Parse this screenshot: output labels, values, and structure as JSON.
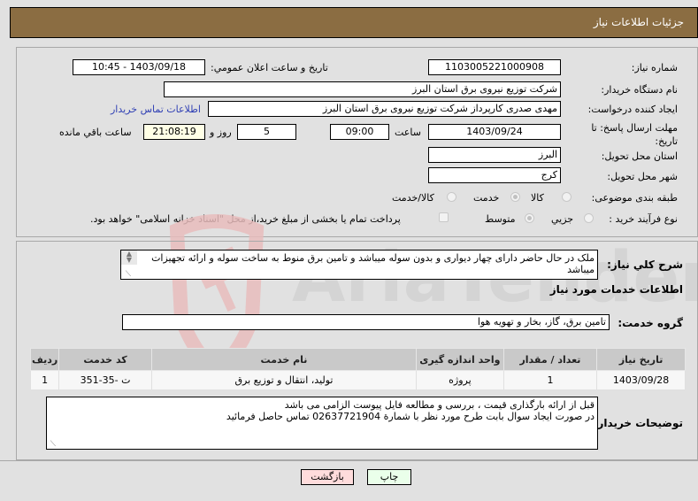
{
  "header": {
    "title": "جزئیات اطلاعات نیاز"
  },
  "form": {
    "need_number_label": "شماره نیاز:",
    "need_number": "1103005221000908",
    "announce_label": "تاریخ و ساعت اعلان عمومي:",
    "announce_value": "1403/09/18 - 10:45",
    "buyer_org_label": "نام دستگاه خریدار:",
    "buyer_org": "شرکت توزیع نیروی برق استان البرز",
    "creator_label": "ایجاد کننده درخواست:",
    "creator": "مهدی صدری کارپرداز شرکت توزیع نیروی برق استان البرز",
    "contact_link": "اطلاعات تماس خریدار",
    "deadline_label_1": "مهلت ارسال پاسخ: تا",
    "deadline_label_2": "تاریخ:",
    "deadline_date": "1403/09/24",
    "time_label": "ساعت",
    "deadline_time": "09:00",
    "days_value": "5",
    "days_label": "روز و",
    "remaining_time": "21:08:19",
    "remaining_label": "ساعت باقي مانده",
    "province_label": "استان محل تحویل:",
    "province": "البرز",
    "city_label": "شهر محل تحویل:",
    "city": "کرج",
    "category_label": "طبقه بندی موضوعی:",
    "category_options": [
      {
        "label": "کالا",
        "selected": false
      },
      {
        "label": "خدمت",
        "selected": true
      },
      {
        "label": "کالا/خدمت",
        "selected": false
      }
    ],
    "process_label": "نوع فرآیند خرید :",
    "process_options": [
      {
        "label": "جزیي",
        "selected": false
      },
      {
        "label": "متوسط",
        "selected": true
      }
    ],
    "treasury_checkbox_label": "پرداخت تمام یا بخشی از مبلغ خرید،از محل \"اسناد خزانه اسلامی\" خواهد بود."
  },
  "description": {
    "label": "شرح کلي نیاز:",
    "text": "ملک در حال حاضر دارای چهار دیواری و بدون سوله میباشد و تامین برق منوط به ساخت سوله و ارائه تجهیزات میباشد"
  },
  "services": {
    "section_title": "اطلاعات خدمات مورد نیاز",
    "group_label": "گروه خدمت:",
    "group_value": "تامین برق، گاز، بخار و تهویه هوا",
    "table": {
      "headers": [
        "ردیف",
        "کد خدمت",
        "نام خدمت",
        "واحد اندازه گیری",
        "تعداد / مقدار",
        "تاریخ نیاز"
      ],
      "rows": [
        [
          "1",
          "ت -35-351",
          "تولید، انتقال و توزیع برق",
          "پروژه",
          "1",
          "1403/09/28"
        ]
      ]
    }
  },
  "buyer_notes": {
    "label": "توضیحات خریدار:",
    "text": "قبل از ارائه بارگذاری قیمت ، بررسی و مطالعه فایل پیوست الزامی می باشد\nدر صورت ایجاد سوال بابت طرح مورد نظر با شمارة 02637721904 تماس حاصل فرمائید"
  },
  "buttons": {
    "print": "چاپ",
    "back": "بازگشت"
  },
  "watermark": {
    "text": "AriaTender.neT"
  },
  "colors": {
    "header_bg": "#8b6d42",
    "print_bg": "#eaffea",
    "back_bg": "#ffdcdc",
    "link": "#2f3fb4"
  }
}
